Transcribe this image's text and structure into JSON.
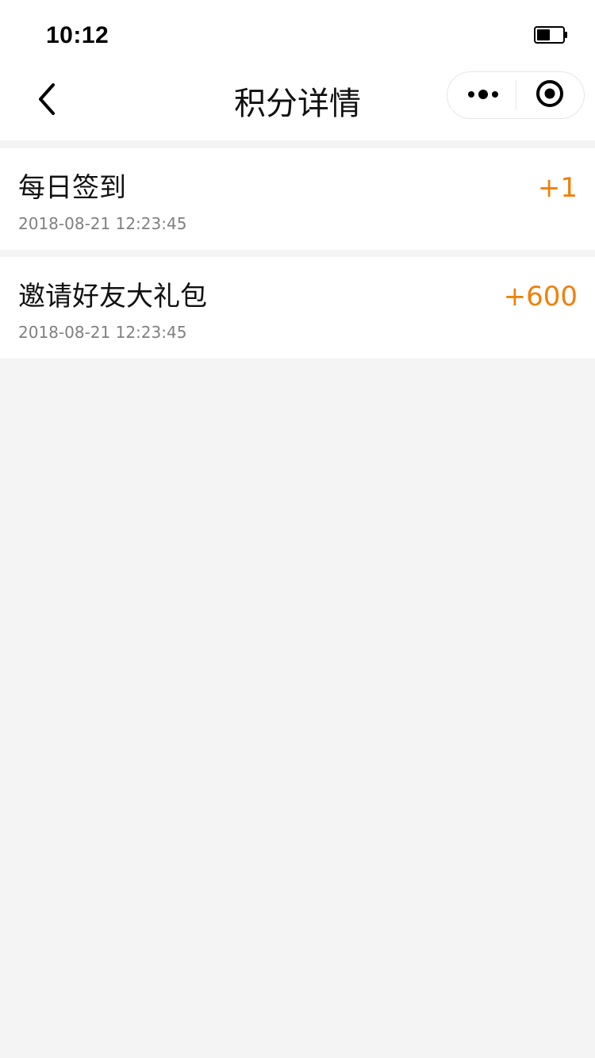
{
  "status_bar": {
    "time": "10:12",
    "battery_icon": "battery-half-icon"
  },
  "nav": {
    "back_icon": "chevron-left-icon",
    "title": "积分详情",
    "more_icon": "more-dots-icon",
    "close_icon": "target-circle-icon"
  },
  "records": [
    {
      "title": "每日签到",
      "time": "2018-08-21 12:23:45",
      "points": "+1"
    },
    {
      "title": "邀请好友大礼包",
      "time": "2018-08-21 12:23:45",
      "points": "+600"
    }
  ],
  "colors": {
    "accent": "#f0800a",
    "page_background": "#f4f4f4",
    "card_background": "#ffffff",
    "secondary_text": "#808080"
  }
}
